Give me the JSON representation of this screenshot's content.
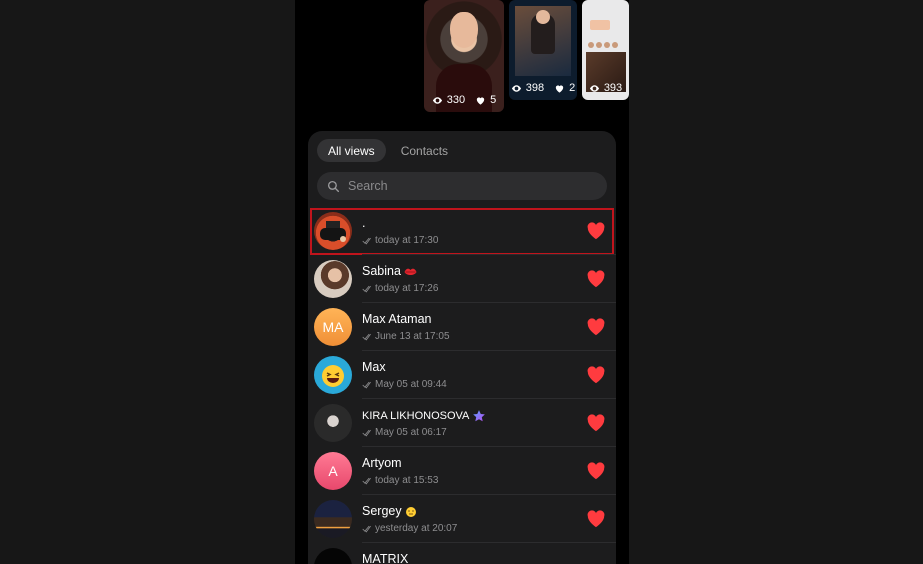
{
  "stories": [
    {
      "views": "330",
      "likes": "5"
    },
    {
      "views": "398",
      "likes": "2"
    },
    {
      "views": "393",
      "likes": ""
    }
  ],
  "tabs": {
    "all_views": "All views",
    "contacts": "Contacts"
  },
  "search": {
    "placeholder": "Search"
  },
  "viewers": [
    {
      "name": ".",
      "time": "today at 17:30",
      "initials": "",
      "emoji": ""
    },
    {
      "name": "Sabina",
      "time": "today at 17:26",
      "initials": "",
      "emoji": "lips"
    },
    {
      "name": "Max Ataman",
      "time": "June 13 at 17:05",
      "initials": "MA",
      "emoji": ""
    },
    {
      "name": "Max",
      "time": "May 05 at 09:44",
      "initials": "",
      "emoji": ""
    },
    {
      "name": "KIRA LIKHONOSOVA",
      "time": "May 05 at 06:17",
      "initials": "",
      "emoji": "star"
    },
    {
      "name": "Artyom",
      "time": "today at 15:53",
      "initials": "A",
      "emoji": ""
    },
    {
      "name": "Sergey",
      "time": "yesterday at 20:07",
      "initials": "",
      "emoji": "sleepy"
    },
    {
      "name": "MATRIX",
      "time": "",
      "initials": "",
      "emoji": ""
    }
  ],
  "colors": {
    "accent_heart": "#ff3b3f",
    "highlight": "#c0141c",
    "avatar_ma": "#f6a24a",
    "avatar_a": "#f0607e",
    "avatar_max": "#2aa9d9"
  }
}
